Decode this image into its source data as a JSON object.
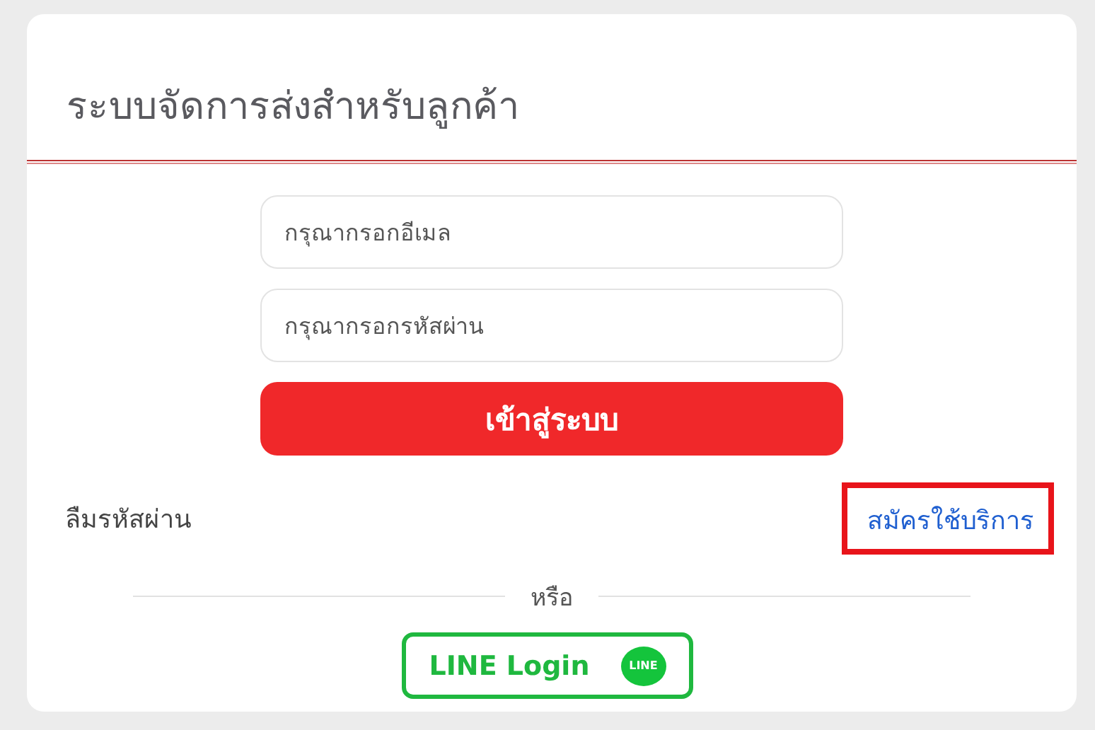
{
  "title": "ระบบจัดการส่งสำหรับลูกค้า",
  "fields": [
    {
      "placeholder": "กรุณากรอกอีเมล"
    },
    {
      "placeholder": "กรุณากรอกรหัสผ่าน"
    }
  ],
  "login_button": "เข้าสู่ระบบ",
  "forgot_link": "ลืมรหัสผ่าน",
  "register_link": {
    "label": "สมัครใช้บริการ",
    "highlighted": true
  },
  "divider_text": "หรือ",
  "line_button": {
    "label": "LINE Login",
    "logo_text": "LINE"
  }
}
